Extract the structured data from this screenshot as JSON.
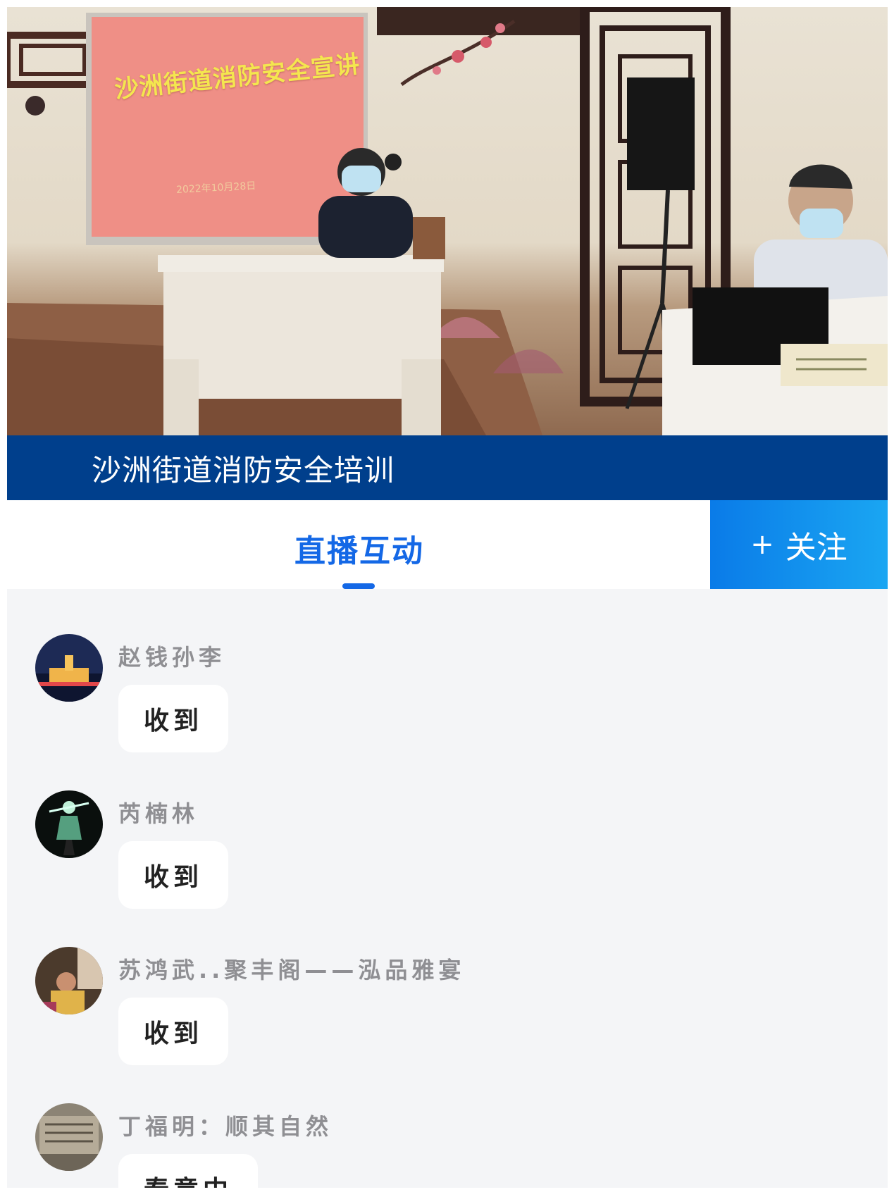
{
  "video": {
    "screen_title": "沙洲街道消防安全宣讲",
    "screen_date": "2022年10月28日"
  },
  "caption": "沙洲街道消防安全培训",
  "tabs": {
    "live_label": "直播互动"
  },
  "follow": {
    "plus": "+",
    "label": "关注"
  },
  "messages": [
    {
      "user": "赵钱孙李",
      "text": "收到"
    },
    {
      "user": "芮楠林",
      "text": "收到"
    },
    {
      "user": "苏鸿武..聚丰阁——泓品雅宴",
      "text": "收到"
    },
    {
      "user": "丁福明：顺其自然",
      "text": "春意中"
    }
  ],
  "colors": {
    "caption_bg": "#003f8c",
    "accent": "#1468e6",
    "follow_bg": "#1aa6f2",
    "chat_bg": "#f4f5f7"
  }
}
